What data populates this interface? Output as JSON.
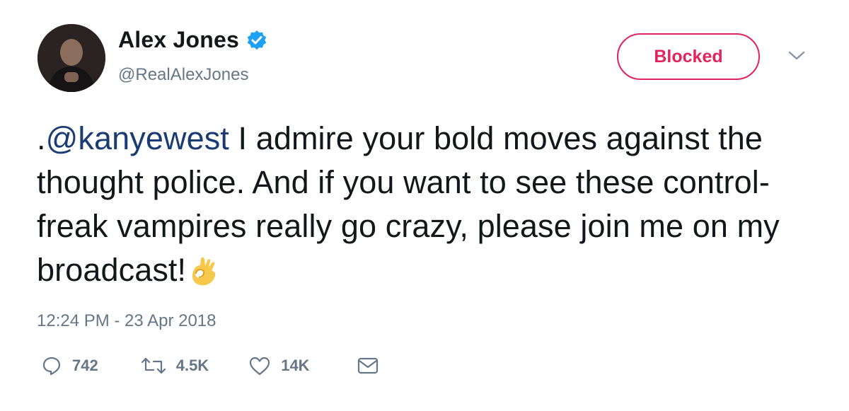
{
  "author": {
    "display_name": "Alex Jones",
    "handle": "@RealAlexJones",
    "verified": true
  },
  "follow_button": {
    "label": "Blocked",
    "color": "#e0245e"
  },
  "menu": {
    "icon": "chevron-down-icon"
  },
  "tweet": {
    "prefix": ".",
    "mention": "@kanyewest",
    "text": " I admire your bold moves against the thought police. And if you want to see these control-freak vampires really go crazy, please join me on my broadcast!",
    "emoji": "ok-hand-icon",
    "timestamp": "12:24 PM - 23 Apr 2018"
  },
  "actions": {
    "replies": "742",
    "retweets": "4.5K",
    "likes": "14K"
  },
  "colors": {
    "text": "#14171a",
    "secondary": "#657786",
    "mention": "#1b3c73",
    "verified": "#1da1f2"
  }
}
